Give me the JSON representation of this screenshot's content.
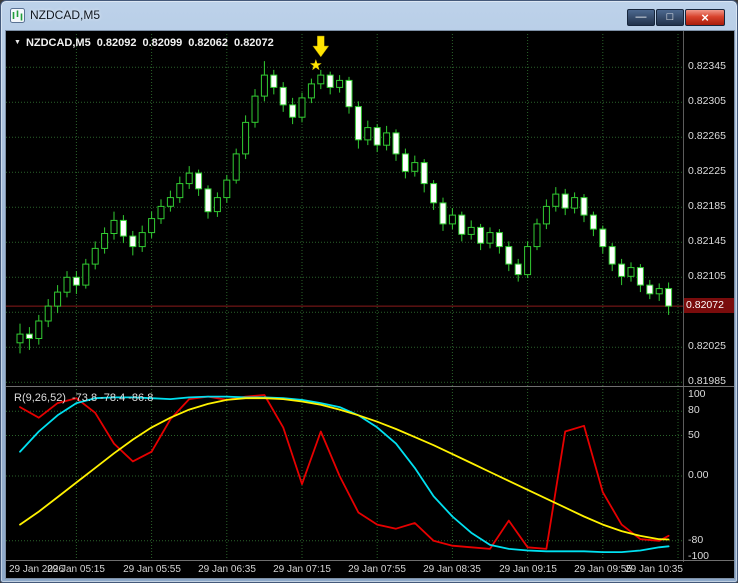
{
  "window": {
    "title": "NZDCAD,M5",
    "controls": {
      "minimize": "—",
      "maximize": "□",
      "close": "×"
    }
  },
  "chart": {
    "header": {
      "marker": "▼",
      "symbol_period": "NZDCAD,M5",
      "open": "0.82092",
      "high": "0.82099",
      "low": "0.82062",
      "close": "0.82072"
    },
    "price_axis": {
      "labels": [
        "0.82345",
        "0.82305",
        "0.82265",
        "0.82225",
        "0.82185",
        "0.82145",
        "0.82105",
        "0.82025",
        "0.81985"
      ],
      "current_price": "0.82072"
    },
    "time_axis": {
      "labels": [
        "29 Jan 2026",
        "29 Jan 05:15",
        "29 Jan 05:55",
        "29 Jan 06:35",
        "29 Jan 07:15",
        "29 Jan 07:55",
        "29 Jan 08:35",
        "29 Jan 09:15",
        "29 Jan 09:55",
        "29 Jan 10:35"
      ]
    }
  },
  "indicator": {
    "label": "R(9,26,52)",
    "values": "-73.8 -78.4 -86.8",
    "axis_labels": [
      "100",
      "80",
      "50",
      "0.00",
      "-80",
      "-100"
    ]
  },
  "annotations": [
    {
      "shape": "arrow-down",
      "bar": 32,
      "color": "#ffe400"
    },
    {
      "shape": "star",
      "glyph": "★",
      "bar": 32,
      "color": "#ffe400"
    }
  ],
  "colors": {
    "background": "#000000",
    "grid": "#2a632a",
    "candle": "#32cd32",
    "bull_fill": "#000000",
    "bear_fill": "#ffffff",
    "bid_line": "#8b1a1a",
    "price_box_bg": "#7a0c0c",
    "axis_text": "#dcdcdc",
    "annotation": "#ffe400"
  },
  "chart_data": [
    {
      "type": "candlestick",
      "symbol": "NZDCAD",
      "timeframe": "M5",
      "date": "29 Jan 2026",
      "ylim": [
        0.81985,
        0.82383
      ],
      "grid_prices": [
        0.82345,
        0.82305,
        0.82265,
        0.82225,
        0.82185,
        0.82145,
        0.82105,
        0.82065,
        0.82025,
        0.81985
      ],
      "tick_bars": [
        6,
        14,
        22,
        30,
        38,
        46,
        54,
        62,
        70
      ],
      "bars": [
        [
          "04:45",
          0.8203,
          0.82052,
          0.82018,
          0.8204
        ],
        [
          "04:50",
          0.8204,
          0.82048,
          0.82022,
          0.82035
        ],
        [
          "04:55",
          0.82035,
          0.82062,
          0.82028,
          0.82055
        ],
        [
          "05:00",
          0.82055,
          0.8208,
          0.82048,
          0.82072
        ],
        [
          "05:05",
          0.82072,
          0.82096,
          0.82064,
          0.82088
        ],
        [
          "05:10",
          0.82088,
          0.82112,
          0.82082,
          0.82105
        ],
        [
          "05:15",
          0.82105,
          0.82112,
          0.82086,
          0.82096
        ],
        [
          "05:20",
          0.82096,
          0.82126,
          0.82092,
          0.8212
        ],
        [
          "05:25",
          0.8212,
          0.82146,
          0.82114,
          0.82138
        ],
        [
          "05:30",
          0.82138,
          0.82162,
          0.82132,
          0.82155
        ],
        [
          "05:35",
          0.82155,
          0.8218,
          0.82148,
          0.8217
        ],
        [
          "05:40",
          0.8217,
          0.82176,
          0.82144,
          0.82152
        ],
        [
          "05:45",
          0.82152,
          0.82158,
          0.8213,
          0.8214
        ],
        [
          "05:50",
          0.8214,
          0.82164,
          0.82134,
          0.82156
        ],
        [
          "05:55",
          0.82156,
          0.8218,
          0.8215,
          0.82172
        ],
        [
          "06:00",
          0.82172,
          0.82194,
          0.82166,
          0.82186
        ],
        [
          "06:05",
          0.82186,
          0.82204,
          0.8218,
          0.82196
        ],
        [
          "06:10",
          0.82196,
          0.8222,
          0.8219,
          0.82212
        ],
        [
          "06:15",
          0.82212,
          0.82232,
          0.82206,
          0.82224
        ],
        [
          "06:20",
          0.82224,
          0.82228,
          0.82198,
          0.82206
        ],
        [
          "06:25",
          0.82206,
          0.8221,
          0.82172,
          0.8218
        ],
        [
          "06:30",
          0.8218,
          0.82202,
          0.82174,
          0.82196
        ],
        [
          "06:35",
          0.82196,
          0.82222,
          0.8219,
          0.82216
        ],
        [
          "06:40",
          0.82216,
          0.82252,
          0.82212,
          0.82246
        ],
        [
          "06:45",
          0.82246,
          0.8229,
          0.8224,
          0.82282
        ],
        [
          "06:50",
          0.82282,
          0.8232,
          0.82276,
          0.82312
        ],
        [
          "06:55",
          0.82312,
          0.82352,
          0.82306,
          0.82336
        ],
        [
          "07:00",
          0.82336,
          0.82342,
          0.82314,
          0.82322
        ],
        [
          "07:05",
          0.82322,
          0.82328,
          0.82294,
          0.82302
        ],
        [
          "07:10",
          0.82302,
          0.8231,
          0.8228,
          0.82288
        ],
        [
          "07:15",
          0.82288,
          0.82316,
          0.82282,
          0.8231
        ],
        [
          "07:20",
          0.8231,
          0.82332,
          0.82304,
          0.82326
        ],
        [
          "07:25",
          0.82326,
          0.82342,
          0.8232,
          0.82336
        ],
        [
          "07:30",
          0.82336,
          0.8234,
          0.82314,
          0.82322
        ],
        [
          "07:35",
          0.82322,
          0.82336,
          0.82316,
          0.8233
        ],
        [
          "07:40",
          0.8233,
          0.82334,
          0.82292,
          0.823
        ],
        [
          "07:45",
          0.823,
          0.82306,
          0.82252,
          0.82262
        ],
        [
          "07:50",
          0.82262,
          0.82284,
          0.82256,
          0.82276
        ],
        [
          "07:55",
          0.82276,
          0.8228,
          0.82248,
          0.82256
        ],
        [
          "08:00",
          0.82256,
          0.82278,
          0.8225,
          0.8227
        ],
        [
          "08:05",
          0.8227,
          0.82274,
          0.82238,
          0.82246
        ],
        [
          "08:10",
          0.82246,
          0.82252,
          0.82218,
          0.82226
        ],
        [
          "08:15",
          0.82226,
          0.82244,
          0.8222,
          0.82236
        ],
        [
          "08:20",
          0.82236,
          0.8224,
          0.82202,
          0.82212
        ],
        [
          "08:25",
          0.82212,
          0.82216,
          0.82182,
          0.8219
        ],
        [
          "08:30",
          0.8219,
          0.82196,
          0.82158,
          0.82166
        ],
        [
          "08:35",
          0.82166,
          0.82184,
          0.8216,
          0.82176
        ],
        [
          "08:40",
          0.82176,
          0.8218,
          0.82146,
          0.82154
        ],
        [
          "08:45",
          0.82154,
          0.8217,
          0.82148,
          0.82162
        ],
        [
          "08:50",
          0.82162,
          0.82166,
          0.82136,
          0.82144
        ],
        [
          "08:55",
          0.82144,
          0.82162,
          0.82138,
          0.82156
        ],
        [
          "09:00",
          0.82156,
          0.8216,
          0.82132,
          0.8214
        ],
        [
          "09:05",
          0.8214,
          0.82146,
          0.82112,
          0.8212
        ],
        [
          "09:10",
          0.8212,
          0.82126,
          0.821,
          0.82108
        ],
        [
          "09:15",
          0.82108,
          0.82146,
          0.82104,
          0.8214
        ],
        [
          "09:20",
          0.8214,
          0.82172,
          0.82136,
          0.82166
        ],
        [
          "09:25",
          0.82166,
          0.82194,
          0.8216,
          0.82186
        ],
        [
          "09:30",
          0.82186,
          0.82208,
          0.8218,
          0.822
        ],
        [
          "09:35",
          0.822,
          0.82206,
          0.82176,
          0.82184
        ],
        [
          "09:40",
          0.82184,
          0.82202,
          0.82178,
          0.82196
        ],
        [
          "09:45",
          0.82196,
          0.822,
          0.82168,
          0.82176
        ],
        [
          "09:50",
          0.82176,
          0.8218,
          0.82152,
          0.8216
        ],
        [
          "09:55",
          0.8216,
          0.82164,
          0.82132,
          0.8214
        ],
        [
          "10:00",
          0.8214,
          0.82144,
          0.82112,
          0.8212
        ],
        [
          "10:05",
          0.8212,
          0.82126,
          0.82096,
          0.82106
        ],
        [
          "10:10",
          0.82106,
          0.82122,
          0.821,
          0.82116
        ],
        [
          "10:15",
          0.82116,
          0.8212,
          0.82088,
          0.82096
        ],
        [
          "10:20",
          0.82096,
          0.82102,
          0.8208,
          0.82086
        ],
        [
          "10:25",
          0.82086,
          0.82098,
          0.82078,
          0.82092
        ],
        [
          "10:30",
          0.82092,
          0.82099,
          0.82062,
          0.82072
        ]
      ]
    },
    {
      "type": "line",
      "name": "R(9,26,52)",
      "ylim": [
        -100,
        100
      ],
      "levels": [
        80,
        50,
        0,
        -80
      ],
      "sample_step_bars": 2,
      "current_values": [
        -73.8,
        -78.4,
        -86.8
      ],
      "series": [
        {
          "name": "R fast",
          "color": "#e60000",
          "values": [
            85,
            72,
            90,
            96,
            78,
            40,
            18,
            30,
            70,
            95,
            98,
            94,
            98,
            100,
            60,
            -10,
            55,
            0,
            -45,
            -60,
            -65,
            -58,
            -80,
            -86,
            -88,
            -90,
            -55,
            -88,
            -90,
            55,
            62,
            -20,
            -60,
            -78,
            -80,
            -73.8
          ]
        },
        {
          "name": "R mid",
          "color": "#00e0f0",
          "values": [
            30,
            55,
            75,
            90,
            96,
            97,
            97,
            96,
            95,
            97,
            98,
            98,
            97,
            97,
            96,
            94,
            90,
            85,
            75,
            60,
            40,
            10,
            -25,
            -50,
            -70,
            -85,
            -90,
            -92,
            -93,
            -93,
            -93,
            -94,
            -94,
            -92,
            -88,
            -86.8
          ]
        },
        {
          "name": "R slow",
          "color": "#fff200",
          "values": [
            -60,
            -44,
            -26,
            -8,
            10,
            28,
            45,
            60,
            72,
            82,
            89,
            94,
            96,
            96,
            95,
            92,
            88,
            82,
            75,
            67,
            58,
            48,
            38,
            27,
            16,
            5,
            -6,
            -17,
            -28,
            -39,
            -50,
            -60,
            -68,
            -74,
            -78,
            -78.4
          ]
        }
      ]
    }
  ]
}
